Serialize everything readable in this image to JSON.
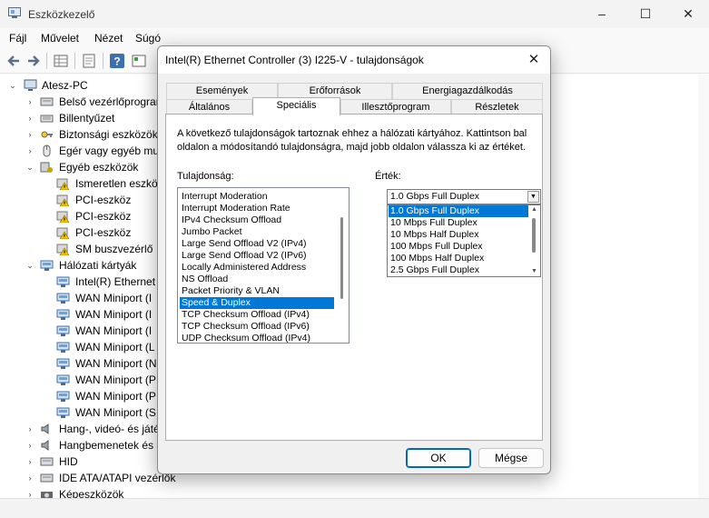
{
  "window": {
    "title": "Eszközkezelő",
    "controls": {
      "minimize": "–",
      "maximize": "☐",
      "close": "✕"
    }
  },
  "menubar": {
    "items": [
      "Fájl",
      "Művelet",
      "Nézet",
      "Súgó"
    ]
  },
  "toolbar": {
    "icons": [
      "back-arrow-icon",
      "forward-arrow-icon",
      "properties-grid-icon",
      "document-icon",
      "help-icon",
      "view-toggle-icon"
    ]
  },
  "tree": {
    "root": "Atesz-PC",
    "items": [
      {
        "label": "Belső vezérlőprogram",
        "expander": "›",
        "icon": "firmware-icon"
      },
      {
        "label": "Billentyűzet",
        "expander": "›",
        "icon": "keyboard-icon"
      },
      {
        "label": "Biztonsági eszközök",
        "expander": "›",
        "icon": "security-key-icon"
      },
      {
        "label": "Egér vagy egyéb mut",
        "expander": "›",
        "icon": "mouse-icon"
      },
      {
        "label": "Egyéb eszközök",
        "expander": "⌄",
        "icon": "other-devices-icon"
      },
      {
        "label": "Ismeretlen eszkö",
        "expander": "",
        "icon": "warning-device-icon"
      },
      {
        "label": "PCI-eszköz",
        "expander": "",
        "icon": "warning-device-icon"
      },
      {
        "label": "PCI-eszköz",
        "expander": "",
        "icon": "warning-device-icon"
      },
      {
        "label": "PCI-eszköz",
        "expander": "",
        "icon": "warning-device-icon"
      },
      {
        "label": "SM buszvezérlő",
        "expander": "",
        "icon": "warning-device-icon"
      },
      {
        "label": "Hálózati kártyák",
        "expander": "⌄",
        "icon": "network-adapter-icon"
      },
      {
        "label": "Intel(R) Ethernet",
        "expander": "",
        "icon": "network-adapter-icon"
      },
      {
        "label": "WAN Miniport (I",
        "expander": "",
        "icon": "network-adapter-icon"
      },
      {
        "label": "WAN Miniport (I",
        "expander": "",
        "icon": "network-adapter-icon"
      },
      {
        "label": "WAN Miniport (I",
        "expander": "",
        "icon": "network-adapter-icon"
      },
      {
        "label": "WAN Miniport (L",
        "expander": "",
        "icon": "network-adapter-icon"
      },
      {
        "label": "WAN Miniport (N",
        "expander": "",
        "icon": "network-adapter-icon"
      },
      {
        "label": "WAN Miniport (P",
        "expander": "",
        "icon": "network-adapter-icon"
      },
      {
        "label": "WAN Miniport (P",
        "expander": "",
        "icon": "network-adapter-icon"
      },
      {
        "label": "WAN Miniport (S",
        "expander": "",
        "icon": "network-adapter-icon"
      },
      {
        "label": "Hang-, videó- és játé",
        "expander": "›",
        "icon": "speaker-icon"
      },
      {
        "label": "Hangbemenetek és -",
        "expander": "›",
        "icon": "speaker-icon"
      },
      {
        "label": "HID",
        "expander": "›",
        "icon": "hid-icon"
      },
      {
        "label": "IDE ATA/ATAPI vezérlők",
        "expander": "›",
        "icon": "ide-controller-icon"
      },
      {
        "label": "Képeszközök",
        "expander": "›",
        "icon": "camera-icon"
      }
    ]
  },
  "dialog": {
    "title": "Intel(R) Ethernet Controller (3) I225-V - tulajdonságok",
    "tabs_row1": [
      "Események",
      "Erőforrások",
      "Energiagazdálkodás"
    ],
    "tabs_row2": [
      "Általános",
      "Speciális",
      "Illesztőprogram",
      "Részletek"
    ],
    "active_tab": "Speciális",
    "description": "A következő tulajdonságok tartoznak ehhez a hálózati kártyához. Kattintson bal oldalon a módosítandó tulajdonságra, majd jobb oldalon válassza ki az értéket.",
    "property_label": "Tulajdonság:",
    "value_label": "Érték:",
    "properties": [
      "Interrupt Moderation",
      "Interrupt Moderation Rate",
      "IPv4 Checksum Offload",
      "Jumbo Packet",
      "Large Send Offload V2 (IPv4)",
      "Large Send Offload V2 (IPv6)",
      "Locally Administered Address",
      "NS Offload",
      "Packet Priority & VLAN",
      "Speed & Duplex",
      "TCP Checksum Offload (IPv4)",
      "TCP Checksum Offload (IPv6)",
      "UDP Checksum Offload (IPv4)"
    ],
    "selected_property": "Speed & Duplex",
    "value_selected": "1.0 Gbps Full Duplex",
    "value_options": [
      "1.0 Gbps Full Duplex",
      "10 Mbps Full Duplex",
      "10 Mbps Half Duplex",
      "100 Mbps Full Duplex",
      "100 Mbps Half Duplex",
      "2.5 Gbps Full Duplex"
    ],
    "ok_label": "OK",
    "cancel_label": "Mégse",
    "close_glyph": "✕"
  },
  "colors": {
    "selection": "#0078d7",
    "accent": "#0067c0"
  }
}
